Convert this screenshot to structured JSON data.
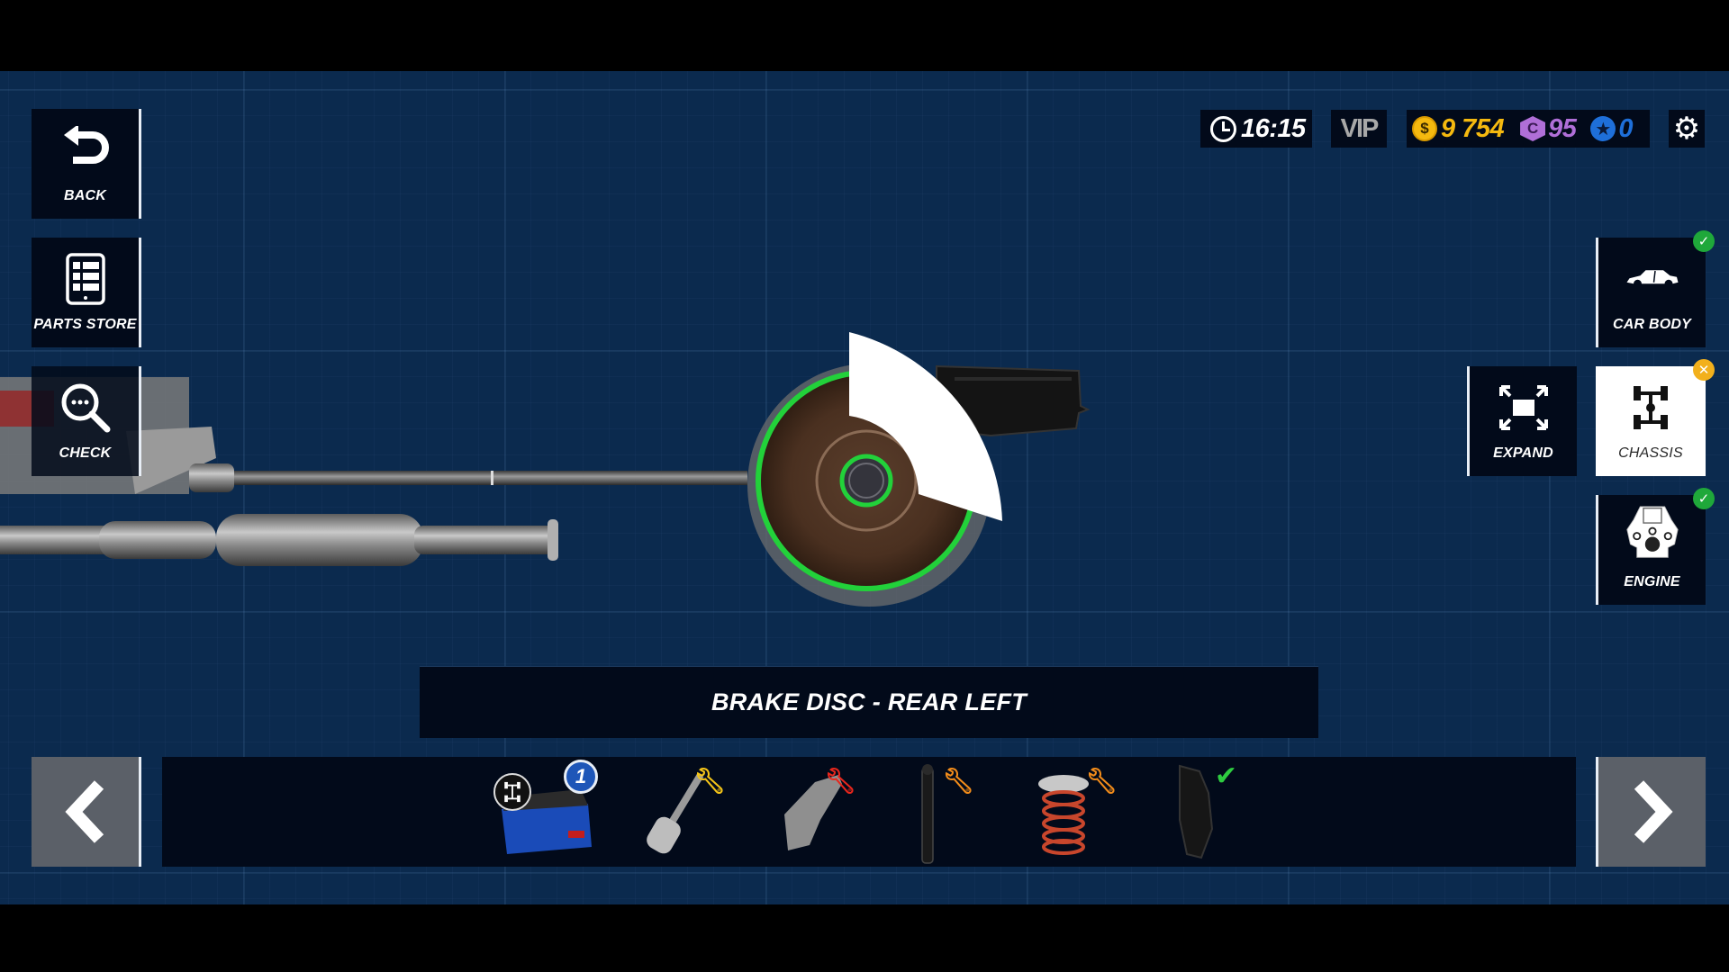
{
  "hud": {
    "time": "16:15",
    "vip_label": "VIP",
    "coins": "9 754",
    "coins_symbol": "$",
    "credits": "95",
    "credits_symbol": "C",
    "stars": "0",
    "colors": {
      "coins": "#f5b90f",
      "credits": "#b06fd8",
      "stars": "#1e6fd9"
    }
  },
  "left_menu": [
    {
      "id": "back",
      "label": "BACK",
      "icon": "undo-arrow-icon"
    },
    {
      "id": "parts-store",
      "label": "PARTS STORE",
      "icon": "tablet-list-icon"
    },
    {
      "id": "check",
      "label": "CHECK",
      "icon": "magnifier-dots-icon"
    }
  ],
  "right_menu": [
    {
      "id": "car-body",
      "label": "CAR BODY",
      "icon": "car-body-icon",
      "status": "complete"
    },
    {
      "id": "expand",
      "label": "EXPAND",
      "icon": "expand-arrows-icon"
    },
    {
      "id": "chassis",
      "label": "CHASSIS",
      "icon": "chassis-icon",
      "status": "incomplete",
      "selected": true
    },
    {
      "id": "engine",
      "label": "ENGINE",
      "icon": "engine-icon",
      "status": "complete"
    }
  ],
  "selected_part": "BRAKE DISC - REAR LEFT",
  "parts_bar": {
    "items": [
      {
        "name": "toolbox",
        "count": "1",
        "category_icon": "chassis-icon"
      },
      {
        "name": "tie-rod",
        "status": "repair-needed",
        "wrench_color": "#f5c518"
      },
      {
        "name": "control-arm",
        "status": "damaged",
        "wrench_color": "#e8261c"
      },
      {
        "name": "shock-absorber",
        "status": "repair-needed",
        "wrench_color": "#f28c1a"
      },
      {
        "name": "coil-spring",
        "status": "repair-needed",
        "wrench_color": "#f28c1a"
      },
      {
        "name": "brake-caliper",
        "status": "ok",
        "check_color": "#2ecc40"
      }
    ],
    "prev_icon": "chevron-left-icon",
    "next_icon": "chevron-right-icon"
  },
  "status_colors": {
    "complete": "#1fa83a",
    "incomplete": "#f2b01c",
    "highlight": "#22d13a"
  }
}
